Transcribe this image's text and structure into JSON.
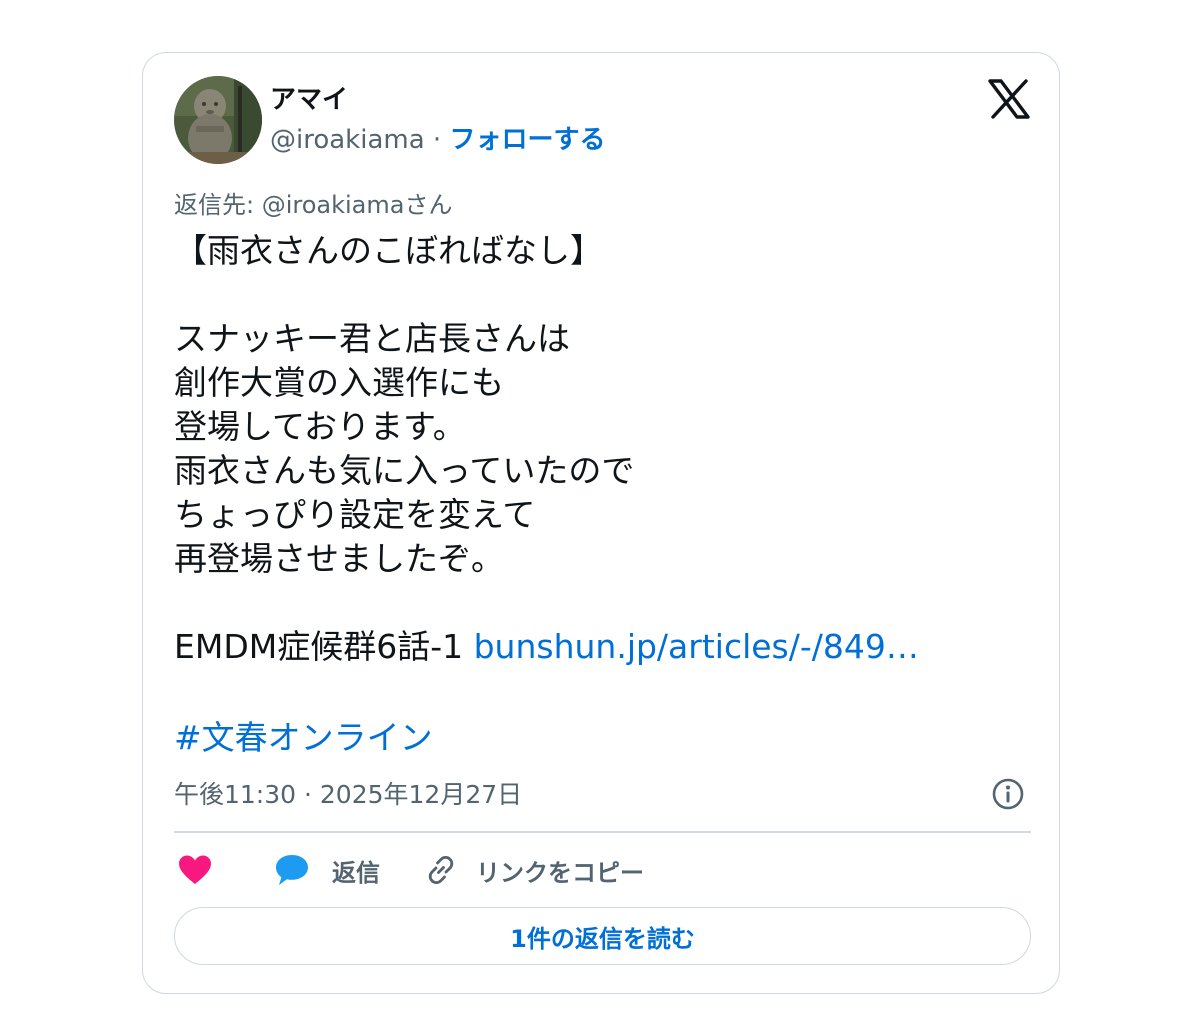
{
  "author": {
    "display_name": "アマイ",
    "handle": "@iroakiama",
    "separator": "·",
    "follow_label": "フォローする"
  },
  "reply_to": "返信先: @iroakiamaさん",
  "tweet": {
    "lines": [
      "【雨衣さんのこぼればなし】",
      "",
      "スナッキー君と店長さんは",
      "創作大賞の入選作にも",
      "登場しております。",
      "雨衣さんも気に入っていたので",
      "ちょっぴり設定を変えて",
      "再登場させましたぞ。",
      "",
      "EMDM症候群6話-1 "
    ],
    "link_text": "bunshun.jp/articles/-/849…",
    "hashtag": "#文春オンライン"
  },
  "timestamp": "午後11:30 · 2025年12月27日",
  "actions": {
    "like_label": "",
    "reply_label": "返信",
    "copy_link_label": "リンクをコピー"
  },
  "read_replies_label": "1件の返信を読む",
  "icons": {
    "logo": "x-logo-icon",
    "info": "info-icon",
    "like": "heart-icon",
    "reply": "speech-bubble-icon",
    "copy": "link-icon"
  },
  "colors": {
    "link": "#006fd6",
    "text": "#0f1419",
    "secondary": "#536471",
    "border": "#cfd9de",
    "heart": "#f91880",
    "reply_bubble": "#1d9bf0"
  }
}
